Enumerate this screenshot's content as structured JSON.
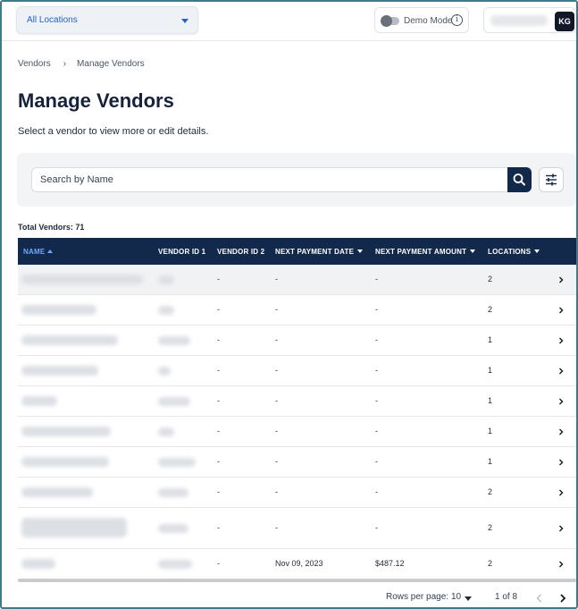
{
  "header": {
    "location_select": "All Locations",
    "demo_mode_label": "Demo Mode",
    "user_initials": "KG"
  },
  "breadcrumb": [
    "Vendors",
    "Manage Vendors"
  ],
  "page_title": "Manage Vendors",
  "subtitle": "Select a vendor to view more or edit details.",
  "search": {
    "placeholder": "Search by Name"
  },
  "total_label": "Total Vendors: 71",
  "table": {
    "columns": [
      "NAME",
      "VENDOR ID 1",
      "VENDOR ID 2",
      "NEXT PAYMENT DATE",
      "NEXT PAYMENT AMOUNT",
      "LOCATIONS"
    ],
    "rows": [
      {
        "vendor_id_2": "-",
        "next_payment_date": "-",
        "next_payment_amount": "-",
        "locations": "2"
      },
      {
        "vendor_id_2": "-",
        "next_payment_date": "-",
        "next_payment_amount": "-",
        "locations": "2"
      },
      {
        "vendor_id_2": "-",
        "next_payment_date": "-",
        "next_payment_amount": "-",
        "locations": "1"
      },
      {
        "vendor_id_2": "-",
        "next_payment_date": "-",
        "next_payment_amount": "-",
        "locations": "1"
      },
      {
        "vendor_id_2": "-",
        "next_payment_date": "-",
        "next_payment_amount": "-",
        "locations": "1"
      },
      {
        "vendor_id_2": "-",
        "next_payment_date": "-",
        "next_payment_amount": "-",
        "locations": "1"
      },
      {
        "vendor_id_2": "-",
        "next_payment_date": "-",
        "next_payment_amount": "-",
        "locations": "1"
      },
      {
        "vendor_id_2": "-",
        "next_payment_date": "-",
        "next_payment_amount": "-",
        "locations": "2"
      },
      {
        "vendor_id_2": "-",
        "next_payment_date": "-",
        "next_payment_amount": "-",
        "locations": "2"
      },
      {
        "vendor_id_2": "-",
        "next_payment_date": "Nov 09, 2023",
        "next_payment_amount": "$487.12",
        "locations": "2"
      }
    ]
  },
  "pagination": {
    "rows_per_page_label": "Rows per page:",
    "rows_per_page_value": "10",
    "page_indicator": "1 of 8"
  },
  "icons": {
    "search": "search-icon",
    "filter": "sliders-icon",
    "info": "info-icon",
    "row_chevron": "chevron-right-icon"
  },
  "colors": {
    "primary": "#13294b",
    "accent": "#2563c9",
    "sort_active": "#6ea8ff"
  }
}
